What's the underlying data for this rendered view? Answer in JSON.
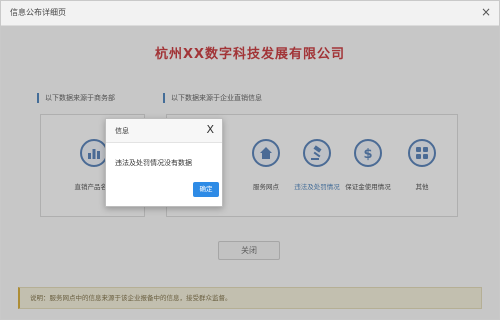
{
  "window": {
    "title": "信息公布详细页",
    "close_glyph": "×"
  },
  "company": {
    "name": "杭州XX数字科技发展有限公司"
  },
  "sections": {
    "left_label": "以下数据来源于商务部",
    "right_label": "以下数据来源于企业直销信息"
  },
  "left_cards": [
    {
      "label": "直销产品名录",
      "icon": "bar-chart-icon"
    }
  ],
  "right_cards": [
    {
      "label": "",
      "icon": "hidden-icon"
    },
    {
      "label": "服务网点",
      "icon": "house-icon"
    },
    {
      "label": "违法及处罚情况",
      "icon": "gavel-icon"
    },
    {
      "label": "保证金使用情况",
      "icon": "dollar-icon"
    },
    {
      "label": "其他",
      "icon": "grid-icon"
    }
  ],
  "footer": {
    "close_label": "关闭"
  },
  "notice": {
    "text": "说明：服务网点中的信息来源于该企业报备中的信息，接受群众监督。"
  },
  "dialog": {
    "title": "信息",
    "close_glyph": "X",
    "message": "违法及处罚情况没有数据",
    "ok_label": "确定"
  },
  "colors": {
    "accent": "#2f6fb3",
    "brand_red": "#c2171c",
    "ok_button": "#2e8be6"
  }
}
